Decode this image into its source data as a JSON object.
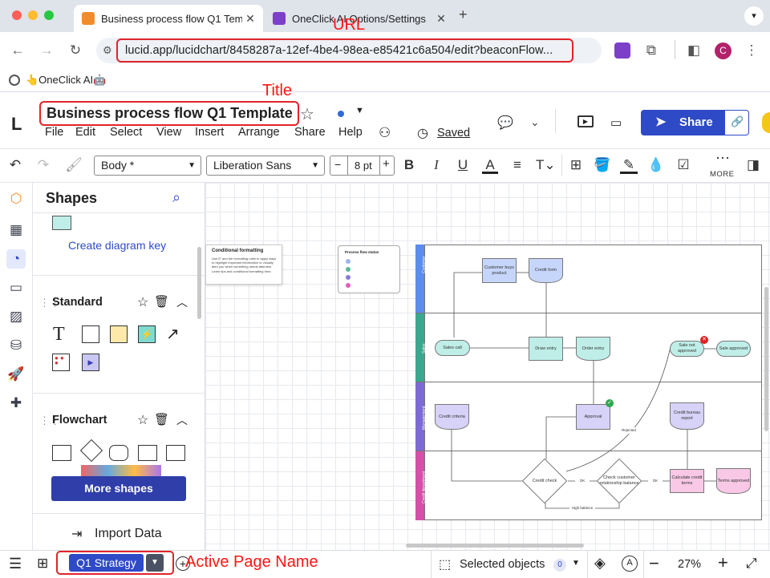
{
  "browser": {
    "tabs": [
      {
        "title": "Business process flow Q1 Tem",
        "active": true
      },
      {
        "title": "OneClick AI Options/Settings",
        "active": false
      }
    ],
    "url": "lucid.app/lucidchart/8458287a-12ef-4be4-98ea-e85421c6a504/edit?beaconFlow...",
    "bookmark": "👆OneClick AI🤖",
    "profile_initial": "C"
  },
  "annotations": {
    "url": "URL",
    "title": "Title",
    "active_page": "Active Page Name"
  },
  "app": {
    "doc_title": "Business process flow Q1 Template",
    "menu": [
      "File",
      "Edit",
      "Select",
      "View",
      "Insert",
      "Arrange",
      "Share",
      "Help"
    ],
    "saved": "Saved",
    "share": "Share"
  },
  "toolbar": {
    "style": "Body *",
    "font": "Liberation Sans",
    "font_size": "8 pt",
    "more": "MORE"
  },
  "panel": {
    "title": "Shapes",
    "diagram_key": "Create diagram key",
    "standard": "Standard",
    "flowchart": "Flowchart",
    "more_shapes": "More shapes",
    "import_data": "Import Data"
  },
  "canvas": {
    "cond_title": "Conditional formatting",
    "cond_body": "Use IF and the formatting rules to apply ways to highlight important information or visually alert you when something needs attention. Learn tips and conditional formatting here.",
    "legend_title": "Process flow status",
    "lanes": [
      "Customer",
      "Sales",
      "Management",
      "Credit department"
    ],
    "nodes": {
      "customer_buys": "Customer buys product",
      "credit_form": "Credit form",
      "sales_call": "Sales call",
      "draw_entry": "Draw entry",
      "order_entry": "Order entry",
      "sale_not_approved": "Sale not approved",
      "sale_approved": "Sale approved",
      "credit_criteria": "Credit criteria",
      "approval": "Approval",
      "credit_report": "Credit bureau report",
      "credit_check": "Credit check",
      "check_relationship": "Check customer relationship balance",
      "calculate_credit": "Calculate credit terms",
      "terms_approved": "Terms approved",
      "ok1": "OK",
      "ok2": "OK",
      "rejected": "Rejected",
      "high_balance": "High balance"
    }
  },
  "bottom": {
    "page_name": "Q1 Strategy",
    "selected_objects": "Selected objects",
    "selected_count": "0",
    "zoom": "27%"
  },
  "colors": {
    "accent": "#2f4ac7",
    "annotation": "#e0242b",
    "customer_lane": "#5b8def",
    "sales_lane": "#3aa88e",
    "management_lane": "#7e6ad6",
    "credit_lane": "#d64fa8"
  }
}
